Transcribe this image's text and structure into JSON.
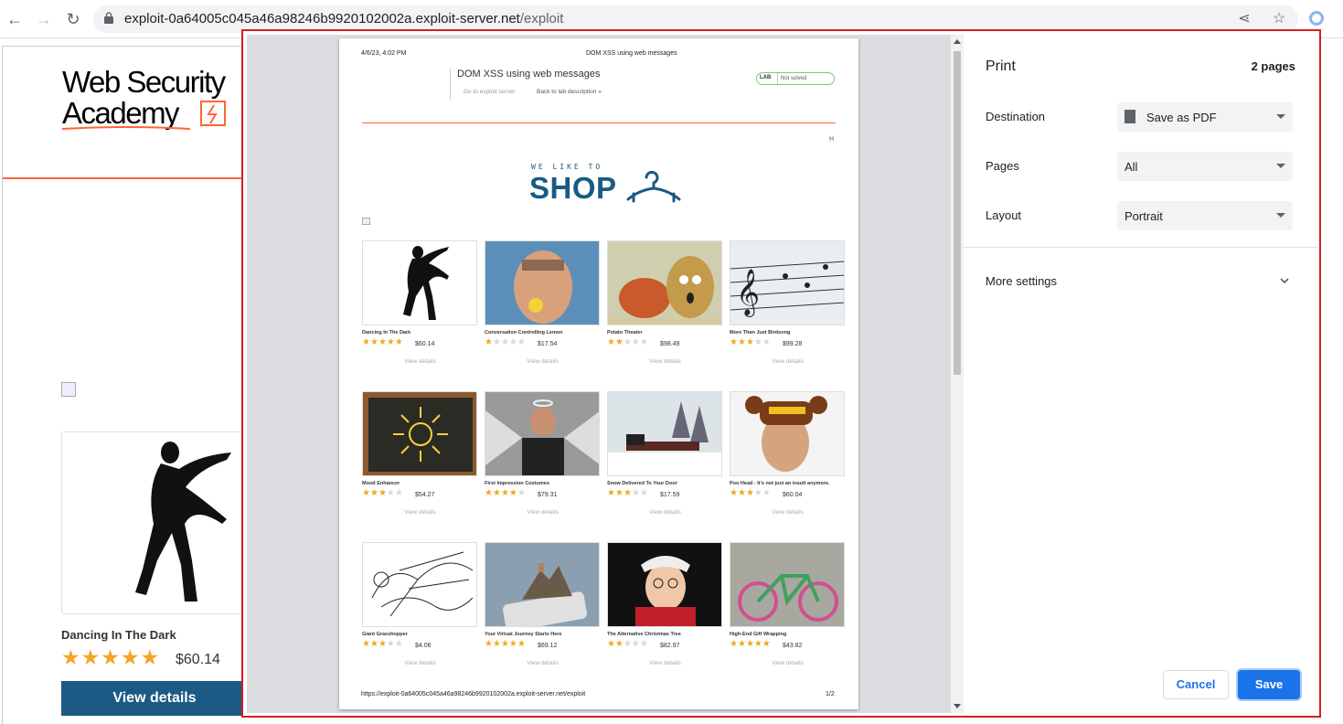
{
  "browser": {
    "url_host": "exploit-0a64005c045a46a98246b9920102002a.exploit-server.net",
    "url_path": "/exploit"
  },
  "background_page": {
    "logo_line1": "Web Security",
    "logo_line2": "Academy",
    "product_title": "Dancing In The Dark",
    "product_stars": "★★★★★",
    "product_price": "$60.14",
    "view_details": "View details"
  },
  "preview": {
    "header_date": "4/6/23, 4:02 PM",
    "header_title": "DOM XSS using web messages",
    "lab_title": "DOM XSS using web messages",
    "link_exploit": "Go to exploit server",
    "link_back": "Back to lab description  »",
    "badge_label": "LAB",
    "badge_status": "Not solved",
    "home_link": "H",
    "shop_small": "WE LIKE TO",
    "shop_big": "SHOP",
    "footer_url": "https://exploit-0a64005c045a46a98246b9920102002a.exploit-server.net/exploit",
    "footer_page": "1/2",
    "view_details": "View details",
    "products": [
      {
        "name": "Dancing In The Dark",
        "rating": 5,
        "price": "$60.14"
      },
      {
        "name": "Conversation Controlling Lemon",
        "rating": 1,
        "price": "$17.54"
      },
      {
        "name": "Potato Theater",
        "rating": 2,
        "price": "$98.49"
      },
      {
        "name": "More Than Just Birdsong",
        "rating": 3,
        "price": "$99.28"
      },
      {
        "name": "Mood Enhancer",
        "rating": 3,
        "price": "$54.27"
      },
      {
        "name": "First Impression Costumes",
        "rating": 4,
        "price": "$79.31"
      },
      {
        "name": "Snow Delivered To Your Door",
        "rating": 3,
        "price": "$17.59"
      },
      {
        "name": "Poo Head - It's not just an insult anymore.",
        "rating": 3,
        "price": "$60.04"
      },
      {
        "name": "Giant Grasshopper",
        "rating": 3,
        "price": "$4.06"
      },
      {
        "name": "Your Virtual Journey Starts Here",
        "rating": 5,
        "price": "$69.12"
      },
      {
        "name": "The Alternative Christmas Tree",
        "rating": 2,
        "price": "$82.97"
      },
      {
        "name": "High-End Gift Wrapping",
        "rating": 5,
        "price": "$43.82"
      }
    ]
  },
  "settings": {
    "title": "Print",
    "pages_count": "2 pages",
    "destination_label": "Destination",
    "destination_value": "Save as PDF",
    "pages_label": "Pages",
    "pages_value": "All",
    "layout_label": "Layout",
    "layout_value": "Portrait",
    "more_settings": "More settings",
    "cancel": "Cancel",
    "save": "Save"
  },
  "colors": {
    "accent_blue": "#1a73e8",
    "highlight_red": "#d81e1e",
    "brand_orange": "#ff6633",
    "shop_blue": "#1a5a85",
    "star": "#f5a623"
  }
}
